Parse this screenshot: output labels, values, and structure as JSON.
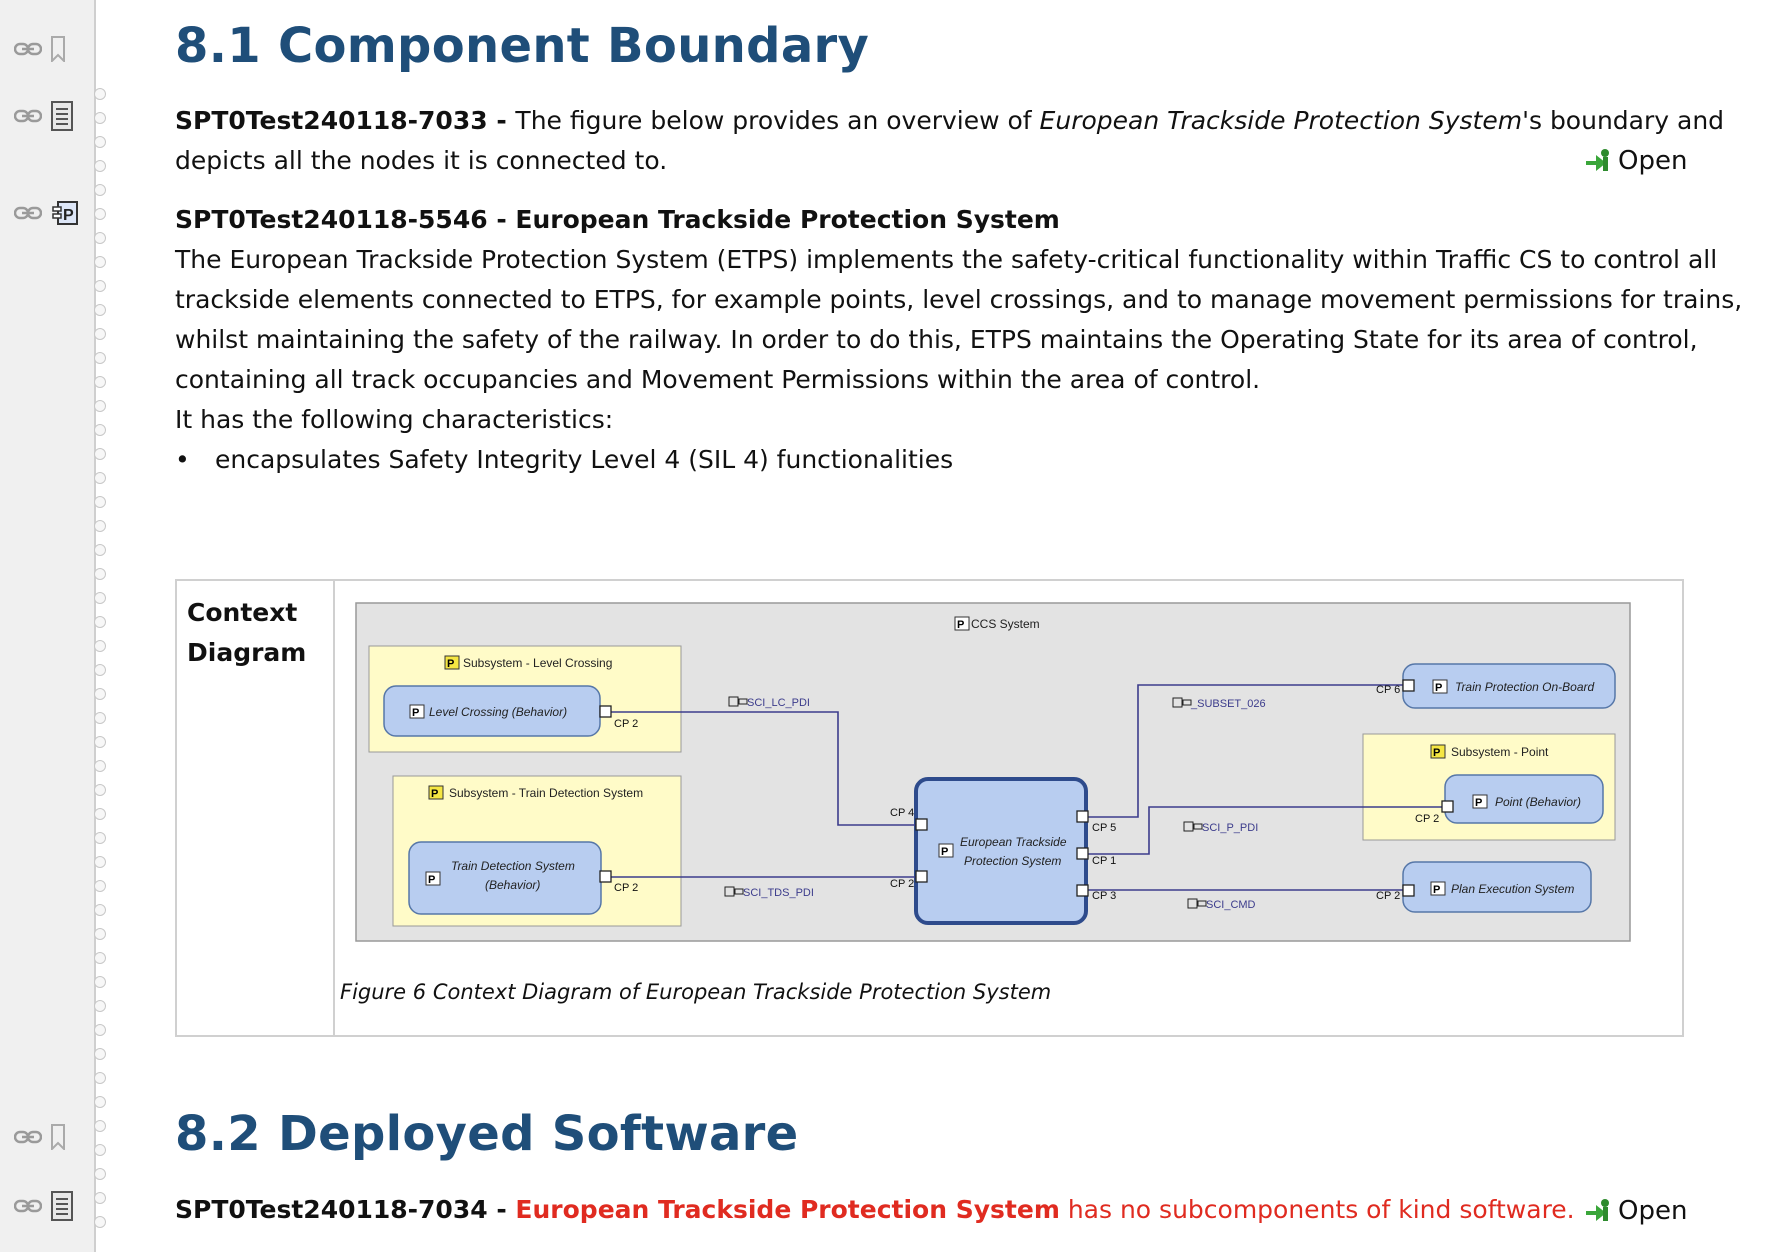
{
  "section1": {
    "heading": "8.1 Component Boundary",
    "req1": {
      "id": "SPT0Test240118-7033",
      "sep": " - ",
      "text_a": "The figure below provides an overview of ",
      "text_italic": "European Trackside Protection System",
      "text_b": "'s boundary and",
      "line2": "depicts all the nodes it is connected to."
    },
    "open_label": "Open",
    "req2": {
      "title": "SPT0Test240118-5546 - European Trackside Protection System",
      "lines": [
        "The European Trackside Protection System (ETPS) implements the safety-critical functionality within Traffic CS to control all",
        "trackside elements connected to ETPS, for example points, level crossings, and to manage movement permissions for trains,",
        "whilst maintaining the safety of the railway. In order to do this, ETPS maintains the Operating State for its area of control,",
        "containing all track occupancies and Movement Permissions within the area of control.",
        "It has the following characteristics:"
      ],
      "bullet": "encapsulates Safety Integrity Level 4 (SIL 4) functionalities"
    },
    "context": {
      "label_line1": "Context",
      "label_line2": "Diagram",
      "caption": "Figure 6 Context Diagram of European Trackside Protection System",
      "diagram": {
        "system": "CCS System",
        "subsystem_lc": "Subsystem - Level Crossing",
        "level_crossing": "Level Crossing (Behavior)",
        "subsystem_tds": "Subsystem - Train Detection System",
        "tds_line1": "Train Detection System",
        "tds_line2": "(Behavior)",
        "etps_line1": "European Trackside",
        "etps_line2": "Protection System",
        "train_protection": "Train Protection On-Board",
        "subsystem_point": "Subsystem - Point",
        "point": "Point (Behavior)",
        "plan_exec": "Plan Execution System",
        "iface_lc": "SCI_LC_PDI",
        "iface_tds": "SCI_TDS_PDI",
        "iface_subset": "_SUBSET_026",
        "iface_p": "SCI_P_PDI",
        "iface_cmd": "SCI_CMD",
        "cp2": "CP 2",
        "cp1": "CP 1",
        "cp3": "CP 3",
        "cp4": "CP 4",
        "cp5": "CP 5",
        "cp6": "CP 6",
        "p_glyph": "P"
      }
    }
  },
  "section2": {
    "heading": "8.2 Deployed Software",
    "req": {
      "id": "SPT0Test240118-7034",
      "sep": " - ",
      "red_bold": "European Trackside Protection System",
      "red_text": " has no subcomponents of kind software."
    },
    "open_label": "Open"
  },
  "colors": {
    "heading": "#1f4e79",
    "warning": "#e02b20",
    "component_fill": "#b8cdf0",
    "subsystem_fill": "#fffbc8",
    "connector": "#3c3c8c"
  }
}
